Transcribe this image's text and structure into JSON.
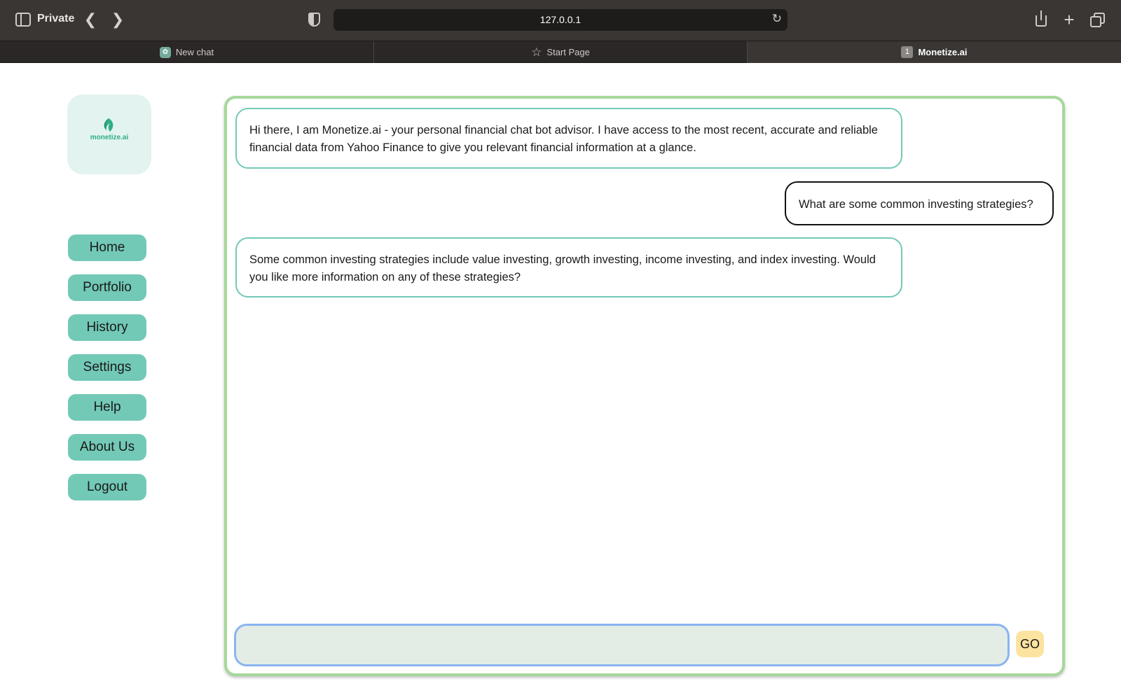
{
  "browser": {
    "private_label": "Private",
    "url": "127.0.0.1",
    "tabs": [
      {
        "label": "New chat",
        "icon": "chatgpt-icon"
      },
      {
        "label": "Start Page",
        "icon": "star-icon"
      },
      {
        "label": "Monetize.ai",
        "icon": "tab-number-icon",
        "badge": "1",
        "active": true
      }
    ]
  },
  "logo": {
    "text": "monetize.ai",
    "icon": "leaf-icon",
    "color": "#2fae86"
  },
  "nav": {
    "items": [
      {
        "label": "Home"
      },
      {
        "label": "Portfolio"
      },
      {
        "label": "History"
      },
      {
        "label": "Settings"
      },
      {
        "label": "Help"
      },
      {
        "label": "About Us"
      },
      {
        "label": "Logout"
      }
    ]
  },
  "chat": {
    "messages": [
      {
        "role": "bot",
        "text": "Hi there, I am Monetize.ai - your personal financial chat bot advisor. I have access to the most recent, accurate and reliable financial data from Yahoo Finance to give you relevant financial information at a glance."
      },
      {
        "role": "user",
        "text": "What are some common investing strategies?"
      },
      {
        "role": "bot",
        "text": "Some common investing strategies include value investing, growth investing, income investing, and index investing. Would you like more information on any of these strategies?"
      }
    ],
    "input_value": "",
    "go_label": "GO"
  },
  "colors": {
    "accent": "#72c9b6",
    "panel_border": "#a6d89a",
    "go_button": "#fce3a0",
    "input_border": "#8ab4f0"
  }
}
